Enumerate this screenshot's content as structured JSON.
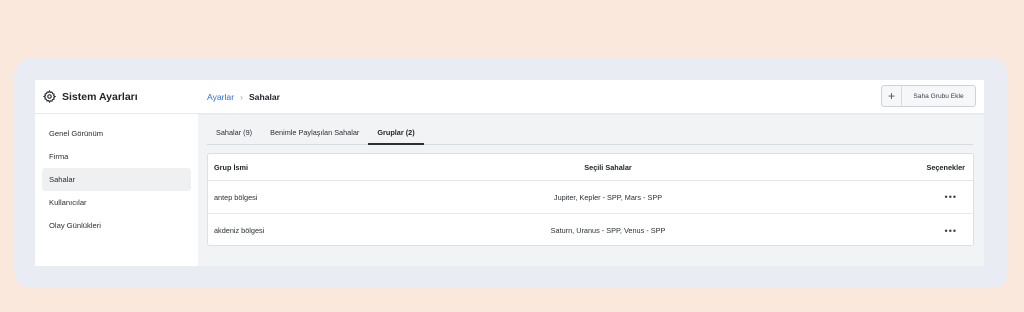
{
  "sidebar": {
    "title": "Sistem Ayarları",
    "icon": "gear-icon",
    "items": [
      {
        "label": "Genel Görünüm"
      },
      {
        "label": "Firma"
      },
      {
        "label": "Sahalar"
      },
      {
        "label": "Kullanıcılar"
      },
      {
        "label": "Olay Günlükleri"
      }
    ],
    "active_index": 2
  },
  "breadcrumb": {
    "parent": "Ayarlar",
    "separator": "›",
    "current": "Sahalar"
  },
  "toolbar": {
    "add_icon": "plus-icon",
    "add_label": "Saha Grubu Ekle"
  },
  "tabs": [
    {
      "label": "Sahalar (9)"
    },
    {
      "label": "Benimle Paylaşılan Sahalar"
    },
    {
      "label": "Gruplar (2)"
    }
  ],
  "active_tab": 2,
  "table": {
    "columns": [
      "Grup İsmi",
      "Seçili Sahalar",
      "Seçenekler"
    ],
    "rows": [
      {
        "name": "antep bölgesi",
        "sites": "Jupiter, Kepler - SPP, Mars - SPP",
        "options": "•••"
      },
      {
        "name": "akdeniz bölgesi",
        "sites": "Saturn, Uranus - SPP, Venus - SPP",
        "options": "•••"
      }
    ]
  },
  "colors": {
    "page_background": "#fbe8dc",
    "frame_background": "#e9ecf3",
    "link": "#2f6fde"
  }
}
